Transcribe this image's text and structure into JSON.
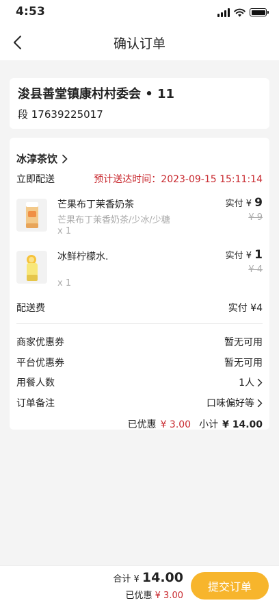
{
  "status_bar": {
    "time": "4:53"
  },
  "nav": {
    "title": "确认订单"
  },
  "address": {
    "line": "浚县善堂镇康村村委会 • 11",
    "contact": "段 17639225017"
  },
  "order": {
    "shop_name": "冰淳茶饮",
    "delivery_label": "立即配送",
    "eta": "预计送达时间：2023-09-15 15:11:14",
    "items": [
      {
        "name": "芒果布丁茉香奶茶",
        "spec": "芒果布丁茉香奶茶/少冰/少糖",
        "qty": "x 1",
        "price_label": "实付 ¥",
        "price": "9",
        "orig_price": "¥ 9"
      },
      {
        "name": "冰鲜柠檬水.",
        "spec": "",
        "qty": "x 1",
        "price_label": "实付 ¥",
        "price": "1",
        "orig_price": "¥ 4"
      }
    ],
    "delivery_fee_label": "配送费",
    "delivery_fee_value": "实付 ¥4",
    "options": [
      {
        "label": "商家优惠券",
        "value": "暂无可用"
      },
      {
        "label": "平台优惠券",
        "value": "暂无可用"
      },
      {
        "label": "用餐人数",
        "value": "1人"
      },
      {
        "label": "订单备注",
        "value": "口味偏好等"
      }
    ],
    "summary": {
      "discount_label": "已优惠",
      "discount_value": "¥ 3.00",
      "subtotal_label": "小计",
      "subtotal_value": "¥ 14.00"
    }
  },
  "bottom": {
    "total_label": "合计",
    "total_currency": "¥",
    "total_value": "14.00",
    "saved_label": "已优惠",
    "saved_value": "¥ 3.00",
    "submit_label": "提交订单"
  },
  "colors": {
    "accent": "#f7b52c",
    "price_red": "#c8282e",
    "background": "#f4f4f4"
  }
}
